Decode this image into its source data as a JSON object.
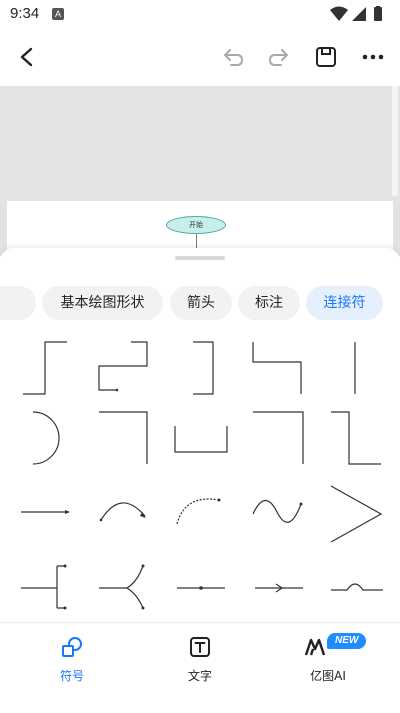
{
  "status_bar": {
    "time": "9:34",
    "notification_letter": "A"
  },
  "canvas": {
    "start_node_label": "开始"
  },
  "categories": [
    {
      "label": "",
      "active": false
    },
    {
      "label": "基本绘图形状",
      "active": false
    },
    {
      "label": "箭头",
      "active": false
    },
    {
      "label": "标注",
      "active": false
    },
    {
      "label": "连接符",
      "active": true
    }
  ],
  "shape_icons": [
    "connector-elbow-up-icon",
    "connector-step-icon",
    "connector-bracket-icon",
    "connector-step-down-icon",
    "connector-vertical-line-icon",
    "connector-arc-icon",
    "connector-corner-icon",
    "connector-u-shape-icon",
    "connector-corner-down-icon",
    "connector-z-step-icon",
    "connector-straight-arrow-icon",
    "connector-curved-arrow-icon",
    "connector-dashed-curve-icon",
    "connector-wave-icon",
    "connector-zigzag-icon",
    "connector-fork-icon",
    "connector-y-split-icon",
    "connector-dot-line-icon",
    "connector-arrow-mid-icon",
    "connector-jump-icon"
  ],
  "bottom_nav": [
    {
      "label": "符号",
      "active": true,
      "icon": "symbol-shapes-icon"
    },
    {
      "label": "文字",
      "active": false,
      "icon": "text-icon"
    },
    {
      "label": "亿图AI",
      "active": false,
      "icon": "ai-logo-icon",
      "badge": "NEW"
    }
  ],
  "colors": {
    "accent": "#1677ff",
    "tab_bg": "#f1f2f4",
    "tab_active_bg": "#e6f0fd",
    "canvas_bg": "#e3e3e3"
  }
}
